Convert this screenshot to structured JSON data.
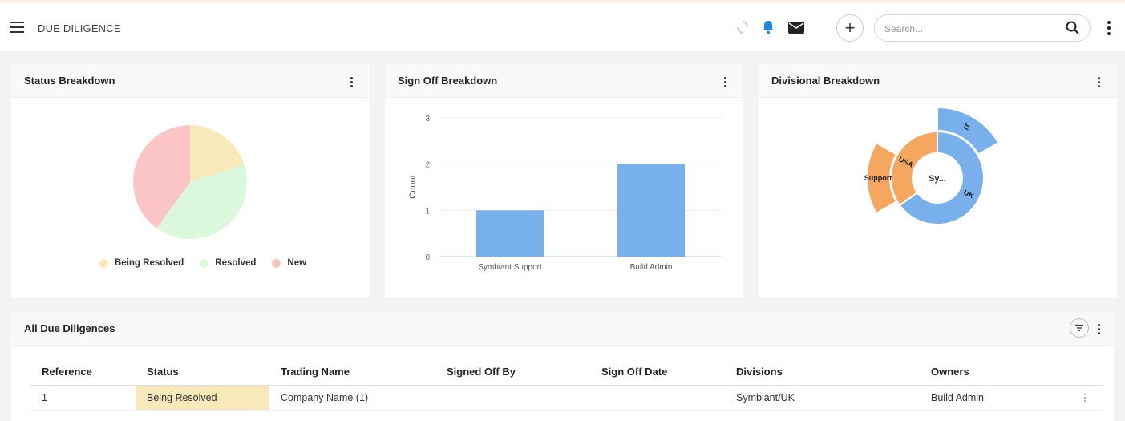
{
  "header": {
    "title": "DUE DILIGENCE",
    "search_placeholder": "Search...",
    "icons": [
      "menu-icon",
      "sync-icon",
      "bell-icon",
      "mail-icon",
      "plus-icon",
      "search-icon",
      "more-vert-icon"
    ],
    "colors": {
      "bell": "#1e88e5",
      "sync": "#c8d4e3",
      "topbar_border": "#fdeee8"
    }
  },
  "status_card": {
    "title": "Status Breakdown",
    "legend": [
      {
        "label": "Being Resolved",
        "color": "#f8e9ba"
      },
      {
        "label": "Resolved",
        "color": "#dcf8dc"
      },
      {
        "label": "New",
        "color": "#fbc5c5"
      }
    ]
  },
  "signoff_card": {
    "title": "Sign Off Breakdown"
  },
  "divisional_card": {
    "title": "Divisional Breakdown",
    "center_label": "Sy...",
    "labels": {
      "it": "IT",
      "uk": "UK",
      "usa": "USA",
      "support": "Support"
    },
    "colors": {
      "blue": "#78b0ec",
      "orange": "#f6a75f"
    }
  },
  "table_card": {
    "title": "All Due Diligences",
    "columns": [
      "Reference",
      "Status",
      "Trading Name",
      "Signed Off By",
      "Sign Off Date",
      "Divisions",
      "Owners"
    ],
    "rows": [
      {
        "reference": "1",
        "status": "Being Resolved",
        "status_color": "#f8e9ba",
        "trading_name": "Company Name (1)",
        "signed_off_by": "",
        "sign_off_date": "",
        "divisions": "Symbiant/UK",
        "owners": "Build Admin"
      }
    ]
  },
  "chart_data": [
    {
      "type": "pie",
      "title": "Status Breakdown",
      "categories": [
        "Being Resolved",
        "Resolved",
        "New"
      ],
      "values": [
        1,
        2,
        2
      ],
      "colors": [
        "#f8e9ba",
        "#dcf8dc",
        "#fbc5c5"
      ]
    },
    {
      "type": "bar",
      "title": "Sign Off Breakdown",
      "categories": [
        "Symbiant Support",
        "Build Admin"
      ],
      "values": [
        1,
        2
      ],
      "ylabel": "Count",
      "ylim": [
        0,
        3
      ],
      "yticks": [
        "0",
        "1",
        "2",
        "3"
      ],
      "color": "#78b0ec",
      "grid": true
    },
    {
      "type": "sunburst",
      "title": "Divisional Breakdown",
      "inner": [
        {
          "label": "UK",
          "value": 3,
          "color": "#78b0ec"
        },
        {
          "label": "USA",
          "value": 2,
          "color": "#f6a75f"
        }
      ],
      "outer": [
        {
          "label": "IT",
          "value": 1,
          "color": "#78b0ec"
        },
        {
          "label": "Support",
          "value": 1,
          "color": "#f6a75f"
        }
      ]
    }
  ]
}
